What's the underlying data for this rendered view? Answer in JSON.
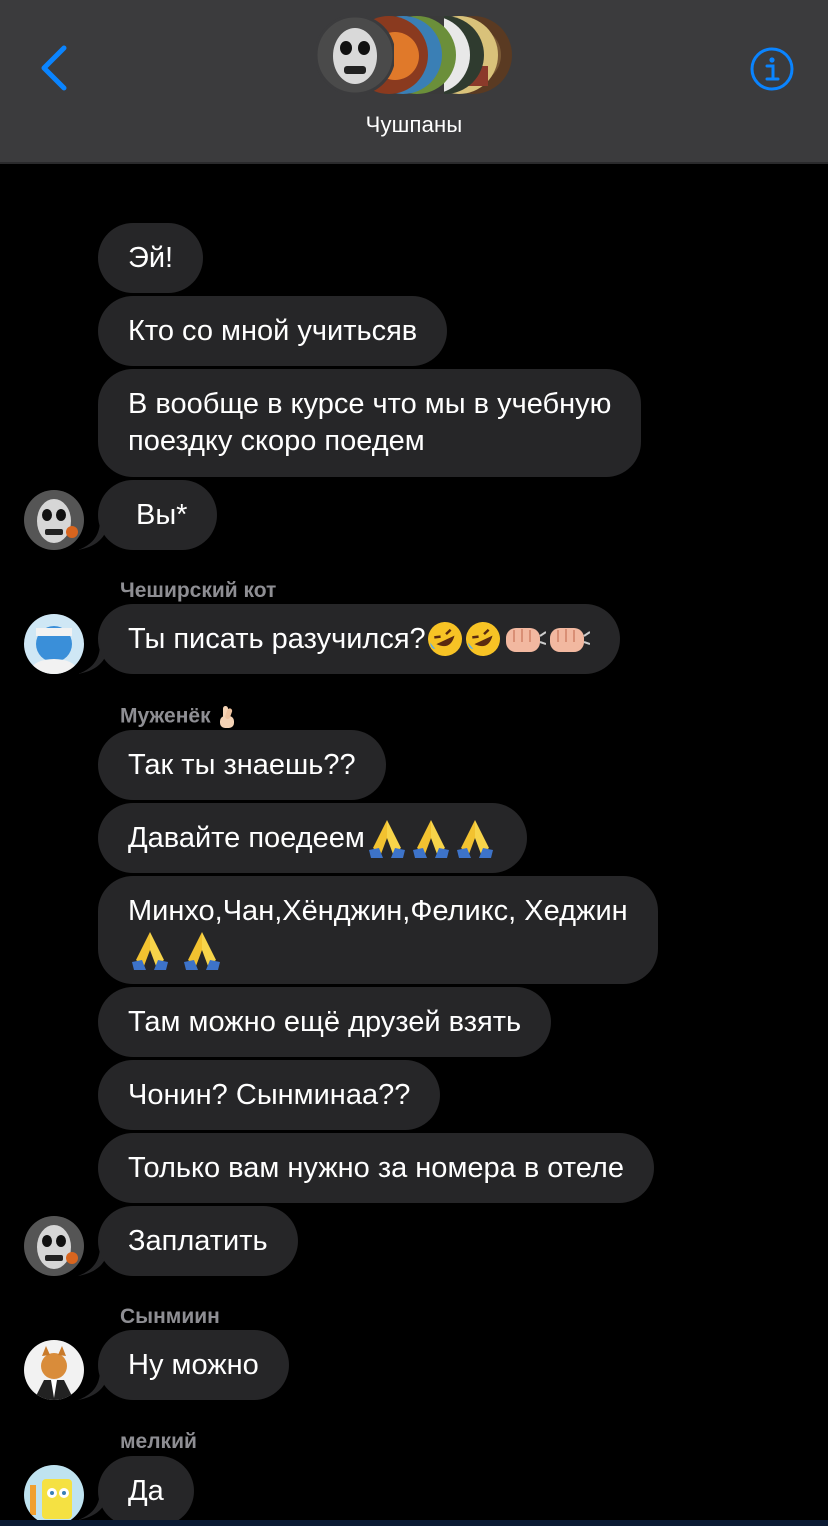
{
  "header": {
    "title": "Чушпаны",
    "back_icon": "chevron-left-icon",
    "info_icon": "info-circle-icon",
    "accent": "#0a84ff"
  },
  "messages": [
    {
      "text": "Эй!"
    },
    {
      "text": "Кто со мной учитьсяв"
    },
    {
      "text": "В вообще в курсе что мы в учебную",
      "text2": "поездку скоро поедем"
    },
    {
      "text": "Вы*"
    },
    {
      "sender": "Чеширский кот",
      "text": "Ты писать разучился?",
      "emojis": [
        "rofl",
        "rofl",
        "fist",
        "fist"
      ]
    },
    {
      "sender": "Муженёк",
      "sender_emoji": "crossed-fingers",
      "text": "Так ты знаешь??"
    },
    {
      "text": "Давайте поедеем",
      "emojis": [
        "pray",
        "pray",
        "pray"
      ]
    },
    {
      "text": "Минхо,Чан,Хёнджин,Феликс, Хеджин",
      "emojis2": [
        "pray",
        "pray"
      ]
    },
    {
      "text": "Там можно ещё друзей взять"
    },
    {
      "text": "Чонин? Сынминаа??"
    },
    {
      "text": "Только вам нужно за номера в отеле"
    },
    {
      "text": "Заплатить"
    },
    {
      "sender": "Сынмиин",
      "text": "Ну можно"
    },
    {
      "sender": "мелкий",
      "text": "Да"
    }
  ]
}
